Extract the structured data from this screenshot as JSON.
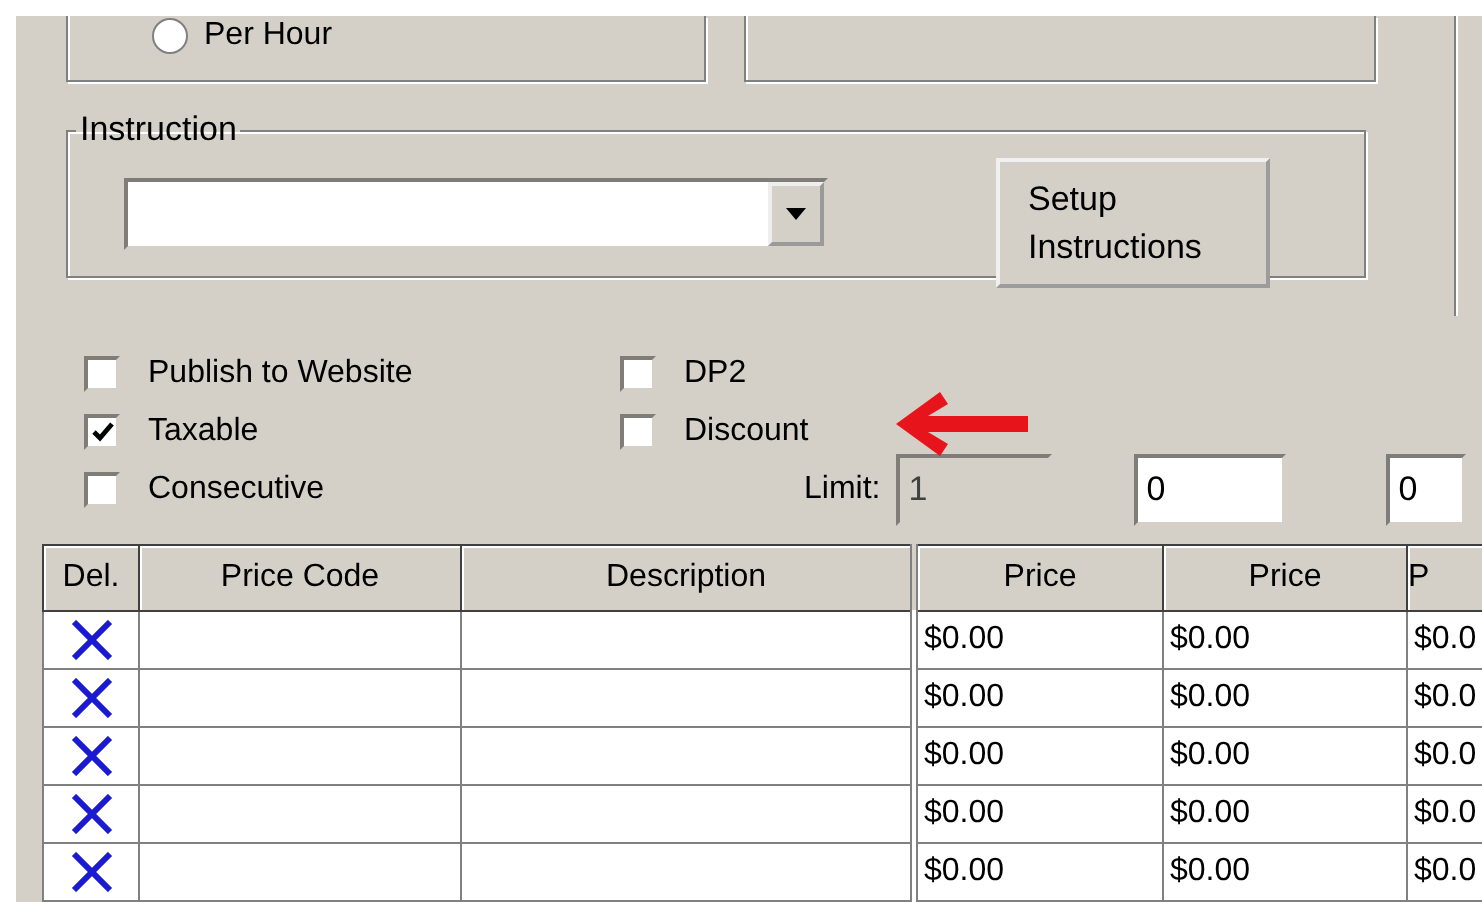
{
  "radio_options": [
    {
      "label": "Per Hour",
      "selected": false
    }
  ],
  "instruction": {
    "legend": "Instruction",
    "button": "Setup Instructions"
  },
  "checkbox_columns": [
    [
      {
        "label": "Publish to Website",
        "checked": false
      },
      {
        "label": "Taxable",
        "checked": true
      },
      {
        "label": "Consecutive",
        "checked": false
      }
    ],
    [
      {
        "label": "DP2",
        "checked": false
      },
      {
        "label": "Discount",
        "checked": false
      }
    ]
  ],
  "limit": {
    "label": "Limit:",
    "value": "1",
    "disabled": true
  },
  "amount_fields": [
    {
      "value": "0"
    },
    {
      "value": "0"
    }
  ],
  "table": {
    "columns": [
      "Del.",
      "Price Code",
      "Description",
      "Price",
      "Price",
      "P"
    ],
    "rows": [
      {
        "prices": [
          "$0.00",
          "$0.00",
          "$0.0"
        ]
      },
      {
        "prices": [
          "$0.00",
          "$0.00",
          "$0.0"
        ]
      },
      {
        "prices": [
          "$0.00",
          "$0.00",
          "$0.0"
        ]
      },
      {
        "prices": [
          "$0.00",
          "$0.00",
          "$0.0"
        ]
      },
      {
        "prices": [
          "$0.00",
          "$0.00",
          "$0.0"
        ]
      }
    ]
  }
}
